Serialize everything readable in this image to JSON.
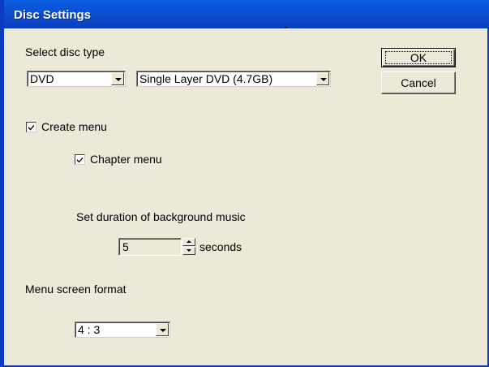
{
  "window": {
    "title": "Disc Settings"
  },
  "disc_type": {
    "label": "Select disc type",
    "type_value": "DVD",
    "capacity_value": "Single Layer DVD (4.7GB)"
  },
  "buttons": {
    "ok": "OK",
    "cancel": "Cancel"
  },
  "create_menu": {
    "label": "Create menu",
    "checked": true
  },
  "chapter_menu": {
    "label": "Chapter menu",
    "checked": true
  },
  "music": {
    "label": "Set duration of background music",
    "value": "5",
    "unit": "seconds"
  },
  "screen_format": {
    "label": "Menu screen format",
    "value": "4 : 3"
  },
  "colors": {
    "titlebar": "#0b4fd1",
    "dialog_bg": "#ece9d8"
  }
}
